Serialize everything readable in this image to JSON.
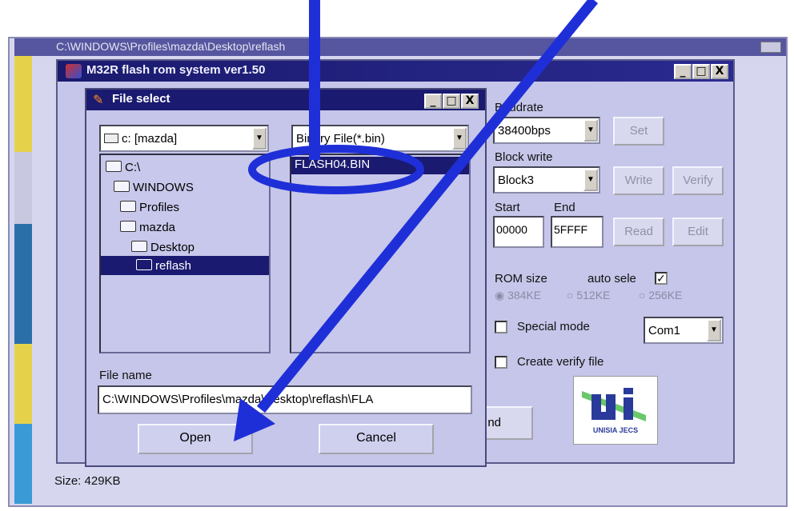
{
  "viewer": {
    "title": "C:\\WINDOWS\\Profiles\\mazda\\Desktop\\reflash",
    "status": "Size: 429KB"
  },
  "m32r": {
    "title": "M32R flash rom system ver1.50",
    "titlebar_buttons": [
      "_",
      "□",
      "X"
    ],
    "baudrate_label": "Baudrate",
    "baudrate_value": "38400bps",
    "set_button": "Set",
    "block_write_label": "Block write",
    "block_value": "Block3",
    "write_button": "Write",
    "verify_button": "Verify",
    "start_label": "Start",
    "end_label": "End",
    "start_value": "00000",
    "end_value": "5FFFF",
    "read_button": "Read",
    "edit_button": "Edit",
    "rom_size_label": "ROM size",
    "auto_select_label": "auto sele",
    "rom_options": [
      "384KE",
      "512KE",
      "256KE"
    ],
    "special_mode_label": "Special mode",
    "com_value": "Com1",
    "create_verify_label": "Create verify file",
    "partial_button": "nd",
    "logo_text": "UNISIA JECS"
  },
  "dialog": {
    "title": "File select",
    "titlebar_buttons": [
      "_",
      "□",
      "X"
    ],
    "drive_value": "c: [mazda]",
    "filter_value": "Binary File(*.bin)",
    "folders": [
      "C:\\",
      "WINDOWS",
      "Profiles",
      "mazda",
      "Desktop",
      "reflash"
    ],
    "files": [
      "FLASH04.BIN"
    ],
    "file_name_label": "File name",
    "file_name_value": "C:\\WINDOWS\\Profiles\\mazda\\Desktop\\reflash\\FLA",
    "open_button": "Open",
    "cancel_button": "Cancel"
  },
  "colors": {
    "annotation": "#1f2fd8",
    "selection": "#1a1a70"
  }
}
